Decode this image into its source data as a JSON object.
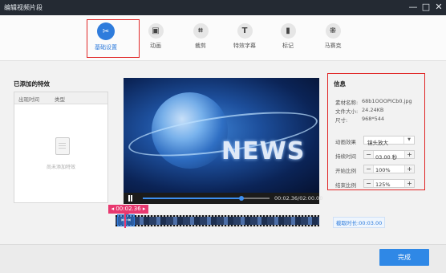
{
  "window": {
    "title": "编辑视频片段",
    "min_icon": "—",
    "max_icon": "□",
    "close_icon": "✕"
  },
  "toolbar": {
    "tools": [
      {
        "label": "基础设置",
        "icon": "scissors-icon",
        "glyph": "✂",
        "active": true
      },
      {
        "label": "动画",
        "icon": "animation-icon",
        "glyph": "▣",
        "active": false
      },
      {
        "label": "裁剪",
        "icon": "crop-icon",
        "glyph": "⌗",
        "active": false
      },
      {
        "label": "特效字幕",
        "icon": "text-icon",
        "glyph": "T",
        "active": false
      },
      {
        "label": "标记",
        "icon": "bookmark-icon",
        "glyph": "▮",
        "active": false
      },
      {
        "label": "马赛克",
        "icon": "mosaic-icon",
        "glyph": "⁜",
        "active": false
      }
    ]
  },
  "effects_panel": {
    "title": "已添加的特效",
    "col_time": "出现时间",
    "col_type": "类型",
    "empty_text": "尚未添加特效"
  },
  "player": {
    "overlay_text": "NEWS",
    "time": "00:02.36/02:00.00",
    "progress": 0.78
  },
  "timeline": {
    "marker_time": "00:02.36",
    "marker_prev": "◂",
    "marker_next": "▸",
    "clip_duration": "截取时长:00:03.00"
  },
  "info": {
    "title": "信息",
    "material_name_label": "素材名称:",
    "material_name": "68b1OOOPICb0.jpg",
    "file_size_label": "文件大小:",
    "file_size": "24.24KB",
    "dimensions_label": "尺寸:",
    "dimensions": "968*544",
    "animation_label": "动画效果",
    "animation_value": "镜头放大",
    "duration_label": "持续时间",
    "duration_value": "03.00 秒",
    "start_ratio_label": "开始比例",
    "start_ratio_value": "100%",
    "end_ratio_label": "结束比例",
    "end_ratio_value": "125%"
  },
  "footer": {
    "done_label": "完成"
  },
  "colors": {
    "accent": "#2f7cdc",
    "highlight": "#e02525",
    "marker": "#e8386f",
    "titlebar": "#242a33"
  }
}
